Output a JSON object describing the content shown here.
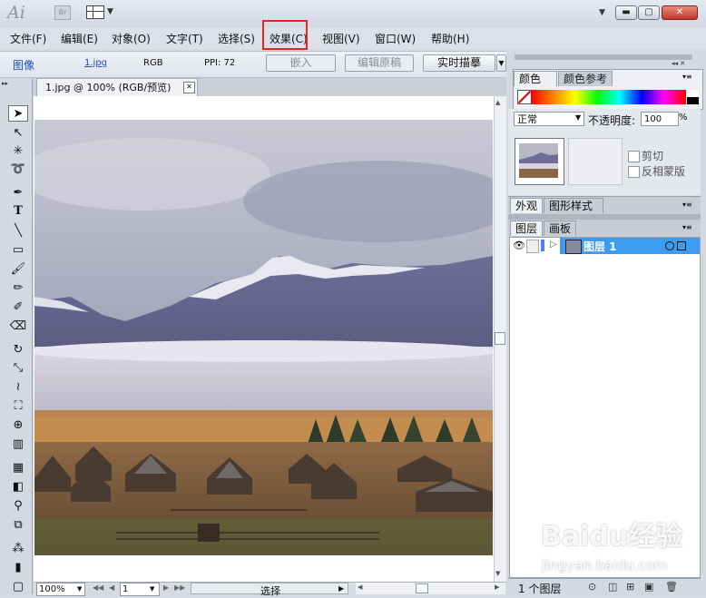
{
  "app": {
    "logo": "Ai",
    "bridge": "Br"
  },
  "window": {
    "minimize": "▬",
    "maximize": "▢",
    "close": "✕"
  },
  "menu": [
    {
      "label": "文件(F)"
    },
    {
      "label": "编辑(E)"
    },
    {
      "label": "对象(O)"
    },
    {
      "label": "文字(T)"
    },
    {
      "label": "选择(S)"
    },
    {
      "label": "效果(C)"
    },
    {
      "label": "视图(V)"
    },
    {
      "label": "窗口(W)"
    },
    {
      "label": "帮助(H)"
    }
  ],
  "control": {
    "type": "图像",
    "file": "1.jpg",
    "mode": "RGB",
    "ppi": "PPI: 72",
    "embed": "嵌入",
    "edit_original": "编辑原稿",
    "live_trace": "实时描摹"
  },
  "document": {
    "tab": "1.jpg @ 100% (RGB/预览)"
  },
  "status": {
    "zoom": "100%",
    "page": "1",
    "tool": "选择"
  },
  "panels": {
    "color": {
      "tab1": "颜色",
      "tab2": "颜色参考"
    },
    "transparency": {
      "blend_mode": "正常",
      "opacity_label": "不透明度:",
      "opacity": "100",
      "opacity_unit": "%",
      "clip": "剪切",
      "invert_mask": "反相蒙版"
    },
    "appearance": {
      "tab1": "外观",
      "tab2": "图形样式"
    },
    "layers": {
      "tab1": "图层",
      "tab2": "画板",
      "layer_name": "图层 1",
      "count": "1 个图层"
    }
  },
  "watermark": {
    "text": "Baidu经验",
    "sub": "jingyan.baidu.com"
  },
  "colors": {
    "highlight": "#e0281f",
    "layer_selected": "#3e9cf0"
  }
}
